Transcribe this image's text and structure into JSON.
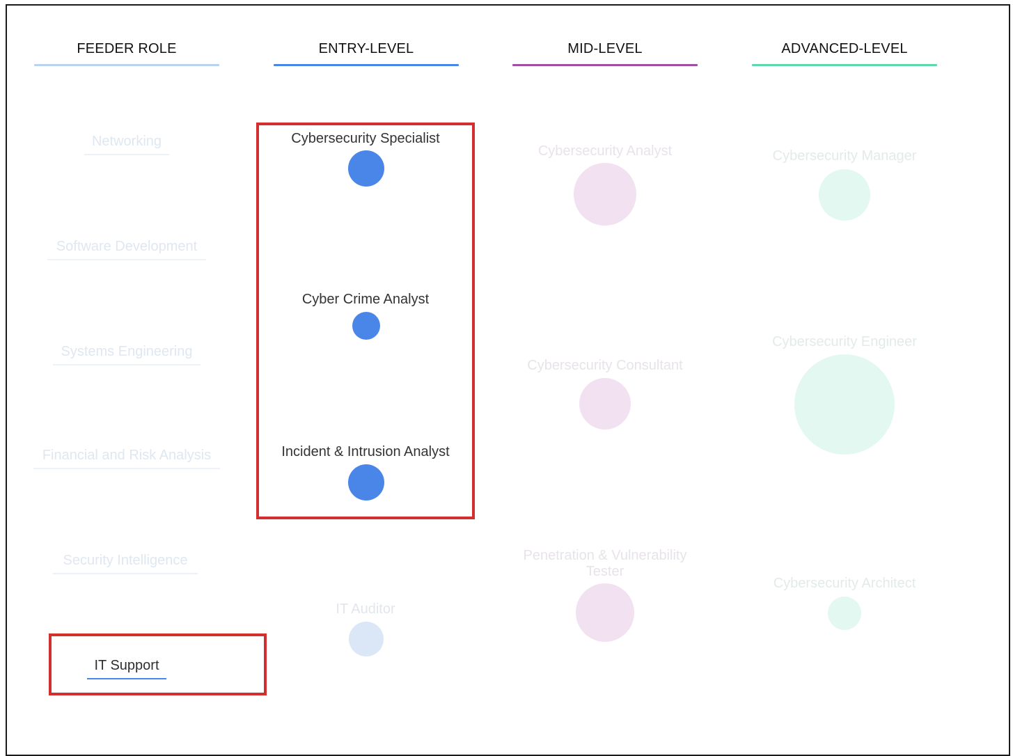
{
  "columns": [
    {
      "label": "FEEDER ROLE",
      "color": "#b9d3f0"
    },
    {
      "label": "ENTRY-LEVEL",
      "color": "#4a86e8"
    },
    {
      "label": "MID-LEVEL",
      "color": "#a24ea8"
    },
    {
      "label": "ADVANCED-LEVEL",
      "color": "#5fd9ab"
    }
  ],
  "feeder_roles": [
    {
      "label": "Networking",
      "state": "faded"
    },
    {
      "label": "Software Development",
      "state": "faded"
    },
    {
      "label": "Systems Engineering",
      "state": "faded"
    },
    {
      "label": "Financial and Risk Analysis",
      "state": "faded"
    },
    {
      "label": "Security Intelligence",
      "state": "faded"
    },
    {
      "label": "IT Support",
      "state": "selected"
    }
  ],
  "entry_level": [
    {
      "title": "Cybersecurity Specialist",
      "state": "highlighted"
    },
    {
      "title": "Cyber Crime Analyst",
      "state": "highlighted"
    },
    {
      "title": "Incident & Intrusion Analyst",
      "state": "highlighted"
    },
    {
      "title": "IT Auditor",
      "state": "faded"
    }
  ],
  "mid_level": [
    {
      "title": "Cybersecurity Analyst",
      "state": "faded"
    },
    {
      "title": "Cybersecurity Consultant",
      "state": "faded"
    },
    {
      "title": "Penetration & Vulnerability",
      "title2": "Tester",
      "state": "faded"
    }
  ],
  "advanced_level": [
    {
      "title": "Cybersecurity Manager",
      "state": "faded"
    },
    {
      "title": "Cybersecurity Engineer",
      "state": "faded"
    },
    {
      "title": "Cybersecurity Architect",
      "state": "faded"
    }
  ],
  "colors": {
    "entry_active": "#4a86e8",
    "entry_faded": "#dbe7f7",
    "mid_faded": "#f2e1f1",
    "advanced_faded": "#e3f8f1",
    "faded_text": "#e2e6ec",
    "highlight_box": "#d32f2f"
  }
}
